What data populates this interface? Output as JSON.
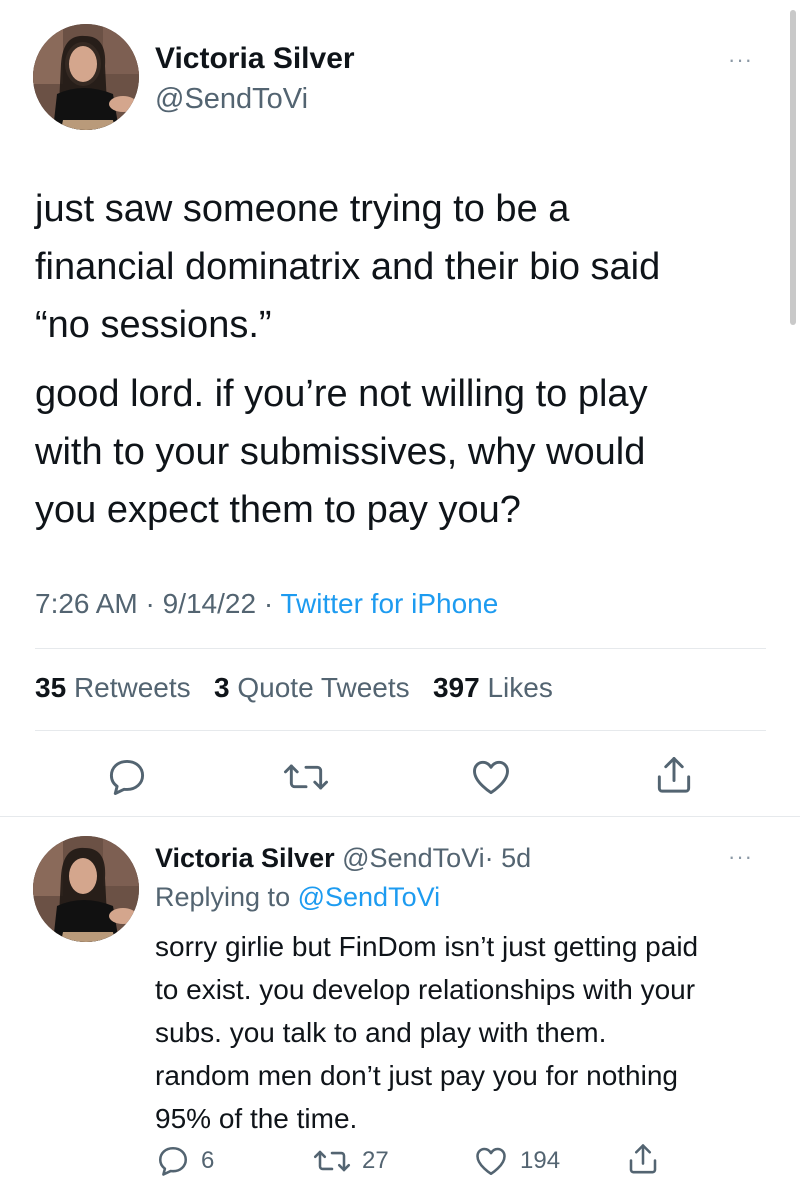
{
  "main_tweet": {
    "author_name": "Victoria Silver",
    "author_handle": "@SendToVi",
    "paragraph_1": [
      "just saw someone trying to be a",
      "financial dominatrix and their bio said",
      "“no sessions.”"
    ],
    "paragraph_2": [
      "good lord. if you’re not willing to play",
      "with to your submissives, why would",
      "you expect them to pay you?"
    ],
    "time": "7:26 AM",
    "date": "9/14/22",
    "separator": "·",
    "source": "Twitter for iPhone",
    "stats": {
      "retweets_count": "35",
      "retweets_label": "Retweets",
      "quotes_count": "3",
      "quotes_label": "Quote Tweets",
      "likes_count": "397",
      "likes_label": "Likes"
    },
    "more_label": "···"
  },
  "reply": {
    "author_name": "Victoria Silver",
    "author_handle": "@SendToVi",
    "age": "· 5d",
    "replying_prefix": "Replying to",
    "replying_handle": "@SendToVi",
    "lines": [
      "sorry girlie but FinDom isn’t just getting paid",
      "to exist. you develop relationships with your",
      "subs. you talk to and play with them.",
      "random men don’t just pay you for nothing",
      "95% of the time."
    ],
    "counts": {
      "replies": "6",
      "retweets": "27",
      "likes": "194"
    },
    "more_label": "···"
  },
  "colors": {
    "accent": "#1d9bf0",
    "muted": "#536471",
    "divider": "#e6e9ec",
    "text": "#0f1419"
  }
}
